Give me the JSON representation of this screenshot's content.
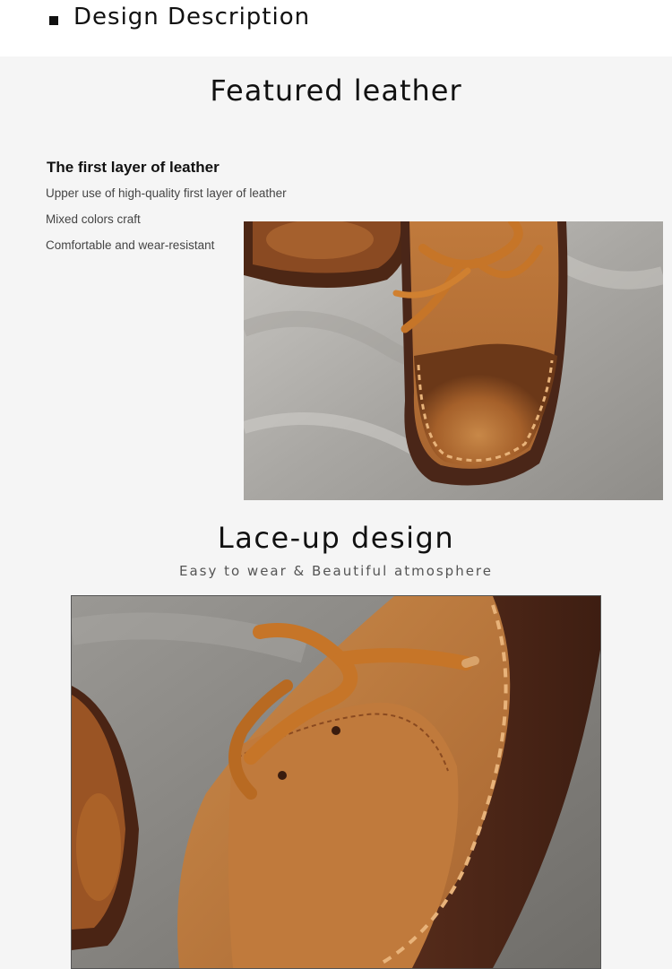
{
  "section": {
    "header": "Design Description",
    "bullet_icon": "square-bullet-icon"
  },
  "featured": {
    "title": "Featured leather",
    "heading": "The first layer of leather",
    "lines": [
      "Upper use of high-quality first layer of leather",
      "Mixed colors craft",
      "Comfortable and wear-resistant"
    ]
  },
  "lace": {
    "title": "Lace-up design",
    "subtitle": "Easy to wear & Beautiful atmosphere"
  },
  "colors": {
    "background": "#f5f5f5",
    "leather": "#b86d2c",
    "lace": "#c67528",
    "sole": "#4a2618"
  }
}
